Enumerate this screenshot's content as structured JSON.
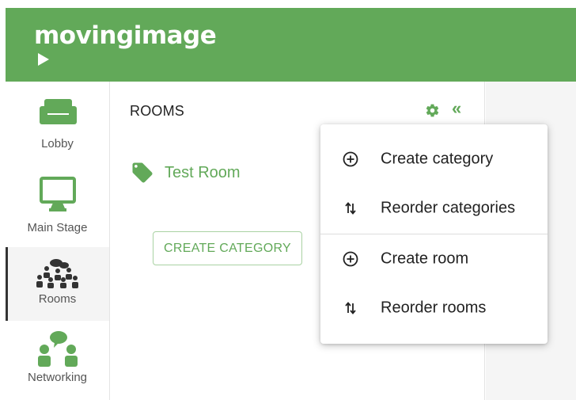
{
  "brand": {
    "logo_text": "movingimage",
    "accent_color": "#62a959"
  },
  "sidebar": {
    "items": [
      {
        "label": "Lobby",
        "icon": "sofa-icon",
        "active": false
      },
      {
        "label": "Main Stage",
        "icon": "monitor-icon",
        "active": false
      },
      {
        "label": "Rooms",
        "icon": "group-chat-icon",
        "active": true
      },
      {
        "label": "Networking",
        "icon": "people-chat-icon",
        "active": false
      }
    ]
  },
  "rooms_panel": {
    "title": "ROOMS",
    "settings_icon": "gear-icon",
    "collapse_icon": "double-chevron-left-icon",
    "rooms": [
      {
        "name": "Test Room",
        "icon": "tag-icon"
      }
    ],
    "create_category_label": "CREATE CATEGORY"
  },
  "menu": {
    "items": [
      {
        "label": "Create category",
        "icon": "add-circle-icon"
      },
      {
        "label": "Reorder categories",
        "icon": "reorder-icon"
      },
      {
        "label": "Create room",
        "icon": "add-circle-icon"
      },
      {
        "label": "Reorder rooms",
        "icon": "reorder-icon"
      }
    ]
  }
}
